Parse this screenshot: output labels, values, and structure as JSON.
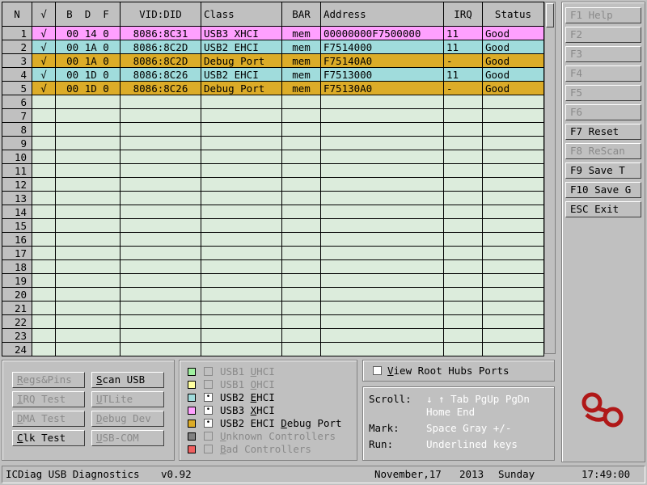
{
  "table": {
    "headers": [
      "N",
      "√",
      "B  D  F",
      "VID:DID",
      "Class",
      "BAR",
      "Address",
      "IRQ",
      "Status"
    ],
    "rows": [
      {
        "n": "1",
        "mark": "√",
        "bdf": "00 14 0",
        "viddid": "8086:8C31",
        "class": "USB3 XHCI",
        "bar": "mem",
        "address": "00000000F7500000",
        "irq": "11",
        "status": "Good",
        "color": "#ffa0ff"
      },
      {
        "n": "2",
        "mark": "√",
        "bdf": "00 1A 0",
        "viddid": "8086:8C2D",
        "class": "USB2 EHCI",
        "bar": "mem",
        "address": "F7514000",
        "irq": "11",
        "status": "Good",
        "color": "#a0dcdc"
      },
      {
        "n": "3",
        "mark": "√",
        "bdf": "00 1A 0",
        "viddid": "8086:8C2D",
        "class": "Debug Port",
        "bar": "mem",
        "address": "F75140A0",
        "irq": "-",
        "status": "Good",
        "color": "#dcac28"
      },
      {
        "n": "4",
        "mark": "√",
        "bdf": "00 1D 0",
        "viddid": "8086:8C26",
        "class": "USB2 EHCI",
        "bar": "mem",
        "address": "F7513000",
        "irq": "11",
        "status": "Good",
        "color": "#a0dcdc"
      },
      {
        "n": "5",
        "mark": "√",
        "bdf": "00 1D 0",
        "viddid": "8086:8C26",
        "class": "Debug Port",
        "bar": "mem",
        "address": "F75130A0",
        "irq": "-",
        "status": "Good",
        "color": "#dcac28"
      }
    ],
    "empty_rows": [
      "6",
      "7",
      "8",
      "9",
      "10",
      "11",
      "12",
      "13",
      "14",
      "15",
      "16",
      "17",
      "18",
      "19",
      "20",
      "21",
      "22",
      "23",
      "24"
    ]
  },
  "fkeys": [
    {
      "label": "F1 Help",
      "enabled": false
    },
    {
      "label": "F2",
      "enabled": false
    },
    {
      "label": "F3",
      "enabled": false
    },
    {
      "label": "F4",
      "enabled": false
    },
    {
      "label": "F5",
      "enabled": false
    },
    {
      "label": "F6",
      "enabled": false
    },
    {
      "label": "F7 Reset",
      "enabled": true
    },
    {
      "label": "F8 ReScan",
      "enabled": false
    },
    {
      "label": "F9 Save T",
      "enabled": true
    },
    {
      "label": "F10 Save G",
      "enabled": true
    },
    {
      "label": "ESC Exit",
      "enabled": true
    }
  ],
  "buttons": {
    "regs_pins": {
      "first": "R",
      "rest": "egs&Pins"
    },
    "scan_usb": {
      "first": "S",
      "rest": "can USB"
    },
    "irq_test": {
      "first": "I",
      "rest": "RQ Test"
    },
    "utlite": {
      "first": "U",
      "rest": "TLite"
    },
    "dma_test": {
      "first": "D",
      "rest": "MA Test"
    },
    "debug_dev": {
      "first": "D",
      "rest": "ebug Dev"
    },
    "clk_test": {
      "first": "C",
      "rest": "lk Test"
    },
    "usb_com": {
      "first": "U",
      "rest": "SB-COM"
    }
  },
  "legend": {
    "uhci": {
      "pre": "USB1 ",
      "u": "U",
      "post": "HCI",
      "color": "#a0f0a0"
    },
    "ohci": {
      "pre": "USB1 ",
      "u": "O",
      "post": "HCI",
      "color": "#ffffa0"
    },
    "ehci": {
      "pre": "USB2 ",
      "u": "E",
      "post": "HCI",
      "color": "#a0dcdc"
    },
    "xhci": {
      "pre": "USB3 ",
      "u": "X",
      "post": "HCI",
      "color": "#ffa0ff"
    },
    "debug": {
      "pre": "USB2 EHCI ",
      "u": "D",
      "post": "ebug Port",
      "color": "#dcac28"
    },
    "unknown": {
      "pre": "",
      "u": "U",
      "post": "nknown Controllers",
      "color": "#808080"
    },
    "bad": {
      "pre": "",
      "u": "B",
      "post": "ad Controllers",
      "color": "#f06060"
    }
  },
  "root_hubs": {
    "u": "V",
    "post": "iew Root Hubs Ports"
  },
  "help": {
    "scroll_label": "Scroll:",
    "scroll_value": "↓ ↑ Tab PgUp PgDn",
    "scroll_value2": "Home End",
    "mark_label": "Mark:",
    "mark_value": "Space Gray +/-",
    "run_label": "Run:",
    "run_value": "Underlined keys"
  },
  "status": {
    "app": "ICDiag USB Diagnostics",
    "version": "v0.92",
    "date": "November,17",
    "year": "2013",
    "day": "Sunday",
    "time": "17:49:00"
  }
}
